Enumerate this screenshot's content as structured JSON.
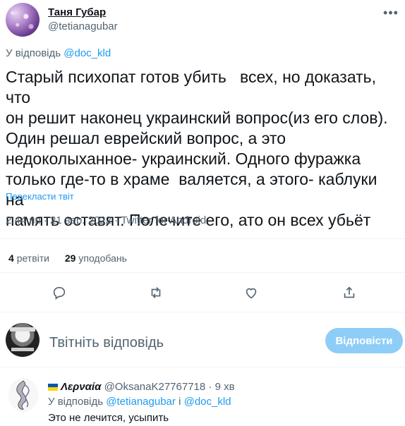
{
  "author": {
    "name": "Таня Губар",
    "handle": "@tetianagubar"
  },
  "reply_context": {
    "prefix": "У відповідь",
    "to": "@doc_kld"
  },
  "tweet": {
    "text": "Старый психопат готов убить   всех, но доказать, что\nон решит наконец украинский вопрос(из его слов).\nОдин решал еврейский вопрос, а это\nнедоколыханное- украинский. Одного фуражка\nтолько где-то в храме  валяется, а этого- каблуки на\nпамять оставят. Полечите его, ато он всех убьёт",
    "translate_label": "Перекласти твіт",
    "time": "2:44 пп",
    "date": "21 вер. 2022",
    "source": "Twitter for Android",
    "separator": "·"
  },
  "stats": {
    "retweets_count": "4",
    "retweets_label": "ретвіти",
    "likes_count": "29",
    "likes_label": "уподобань"
  },
  "icons": {
    "more": "more-icon",
    "reply": "reply-icon",
    "retweet": "retweet-icon",
    "like": "heart-icon",
    "share": "share-icon"
  },
  "composer": {
    "placeholder": "Твітніть відповідь",
    "button_label": "Відповісти",
    "button_color": "#8ecdf8"
  },
  "reply": {
    "name": "Λερναία",
    "handle": "@OksanaK27767718",
    "separator": "·",
    "time": "9 хв",
    "reply_prefix": "У відповідь",
    "reply_to_1": "@tetianagubar",
    "reply_joiner": "і",
    "reply_to_2": "@doc_kld",
    "text": "Это не лечится, усыпить"
  },
  "colors": {
    "accent": "#1d9bf0",
    "muted": "#536471",
    "text": "#0f1419"
  }
}
